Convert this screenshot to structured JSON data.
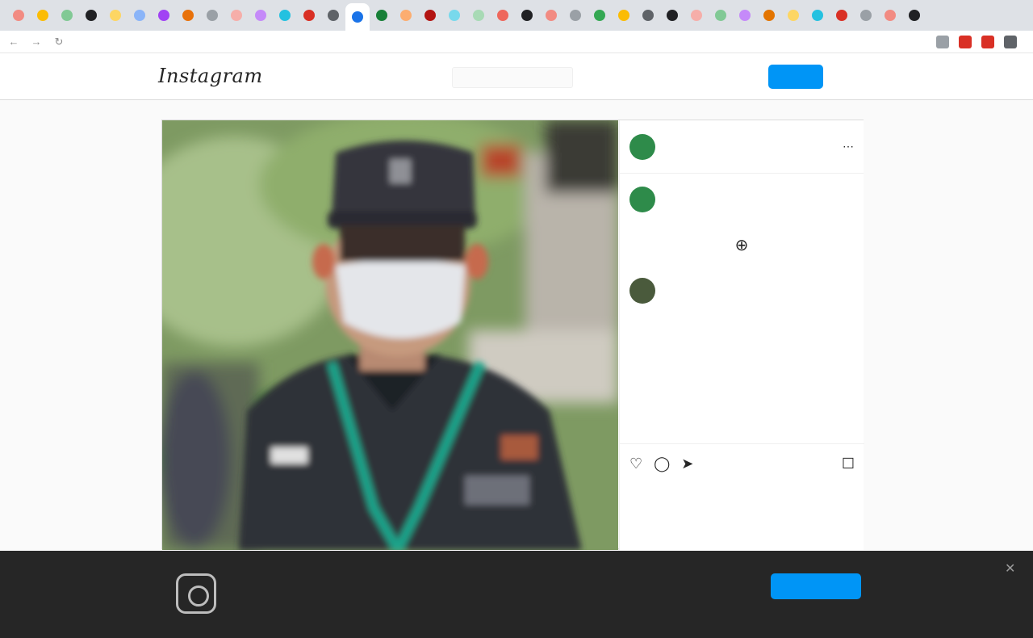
{
  "browser": {
    "tab_colors": [
      "#f28b82",
      "#fbbc04",
      "#81c995",
      "#202124",
      "#fdd663",
      "#8ab4f8",
      "#a142f4",
      "#e8710a",
      "#9aa0a6",
      "#f6aea9",
      "#c58af9",
      "#24c1e0",
      "#d93025",
      "#5f6368",
      "#1a73e8",
      "#188038",
      "#fcad70",
      "#b31412",
      "#78d9ec",
      "#a8dab5",
      "#ee675c",
      "#202124",
      "#f28b82",
      "#9aa0a6",
      "#34a853",
      "#fbbc04",
      "#5f6368",
      "#202124",
      "#f6aea9",
      "#81c995",
      "#c58af9",
      "#e37400",
      "#fdd663",
      "#24c1e0",
      "#d93025",
      "#9aa0a6",
      "#f28b82",
      "#202124"
    ],
    "active_tab_index": 14,
    "url": "",
    "extension_colors": [
      "#9aa0a6",
      "#d93025",
      "#d93025",
      "#5f6368"
    ]
  },
  "header": {
    "logo_text": "Instagram",
    "search_placeholder": "",
    "login_label": "",
    "signup_label": ""
  },
  "post": {
    "username": "",
    "follow_label": "",
    "caption": "",
    "caption_time": "",
    "comment_user": "",
    "comment_text": "",
    "comment_meta": "",
    "likes": "",
    "date": ""
  },
  "banner": {
    "title": "",
    "description": "",
    "open_label": "",
    "signup_label": ""
  },
  "colors": {
    "accent": "#0095f6",
    "banner_bg": "#262626",
    "lanyard": "#1aa38a"
  }
}
